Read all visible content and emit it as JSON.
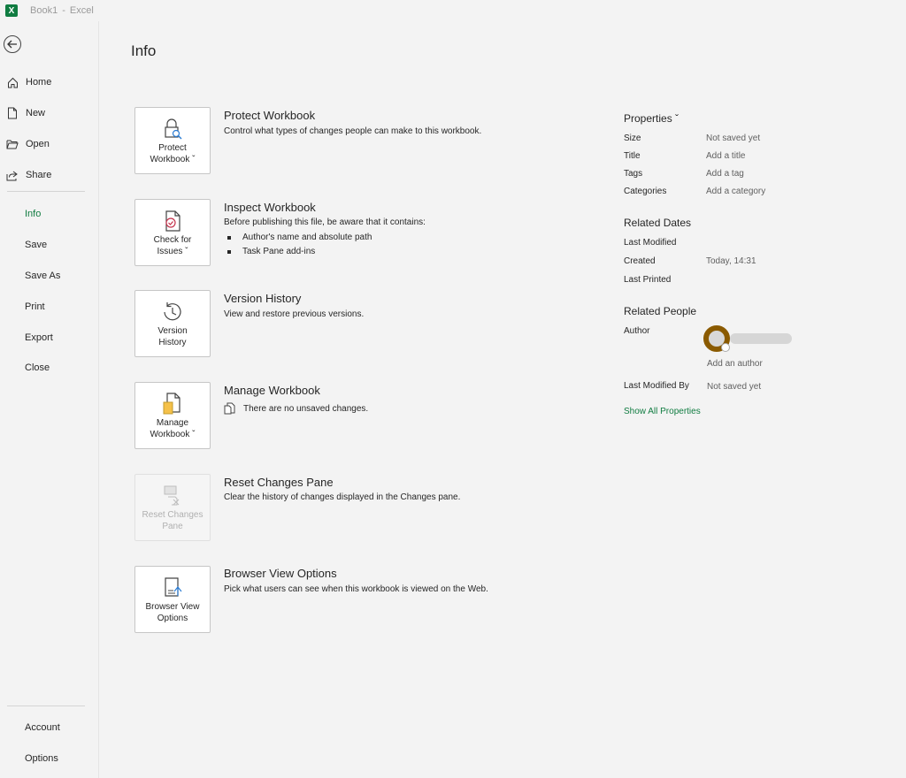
{
  "titlebar": {
    "doc": "Book1",
    "sep": "-",
    "app": "Excel",
    "logo": "X"
  },
  "sidebar": {
    "back_icon": "back-arrow-icon",
    "top_items": [
      {
        "label": "Home",
        "icon": "home-icon"
      },
      {
        "label": "New",
        "icon": "new-document-icon"
      },
      {
        "label": "Open",
        "icon": "open-folder-icon"
      },
      {
        "label": "Share",
        "icon": "share-icon"
      }
    ],
    "mid_items": [
      "Info",
      "Save",
      "Save As",
      "Print",
      "Export",
      "Close"
    ],
    "selected": "Info",
    "bottom_items": [
      "Account",
      "Options"
    ]
  },
  "page_title": "Info",
  "sections": [
    {
      "btn": "Protect\nWorkbook ˇ",
      "icon": "lock-search-icon",
      "title": "Protect Workbook",
      "desc": "Control what types of changes people can make to this workbook."
    },
    {
      "btn": "Check for\nIssues ˇ",
      "icon": "inspect-document-icon",
      "title": "Inspect Workbook",
      "desc": "Before publishing this file, be aware that it contains:",
      "bullets": [
        "Author's name and absolute path",
        "Task Pane add-ins"
      ]
    },
    {
      "btn": "Version\nHistory",
      "icon": "history-clock-icon",
      "title": "Version History",
      "desc": "View and restore previous versions."
    },
    {
      "btn": "Manage\nWorkbook ˇ",
      "icon": "manage-workbook-icon",
      "title": "Manage Workbook",
      "desc": "There are no unsaved changes."
    },
    {
      "btn": "Reset Changes\nPane",
      "icon": "reset-changes-icon",
      "title": "Reset Changes Pane",
      "desc": "Clear the history of changes displayed in the Changes pane.",
      "disabled": true
    },
    {
      "btn": "Browser View\nOptions",
      "icon": "browser-view-icon",
      "title": "Browser View Options",
      "desc": "Pick what users can see when this workbook is viewed on the Web."
    }
  ],
  "properties": {
    "heading": "Properties ˇ",
    "rows": [
      {
        "key": "Size",
        "value": "Not saved yet"
      },
      {
        "key": "Title",
        "value": "Add a title"
      },
      {
        "key": "Tags",
        "value": "Add a tag"
      },
      {
        "key": "Categories",
        "value": "Add a category"
      }
    ],
    "dates_heading": "Related Dates",
    "dates": [
      {
        "key": "Last Modified",
        "value": ""
      },
      {
        "key": "Created",
        "value": "Today, 14:31"
      },
      {
        "key": "Last Printed",
        "value": ""
      }
    ],
    "people_heading": "Related People",
    "author_key": "Author",
    "add_author": "Add an author",
    "last_modified_by_key": "Last Modified By",
    "last_modified_by_value": "Not saved yet",
    "show_all": "Show All Properties",
    "accent_color": "#107c41"
  }
}
